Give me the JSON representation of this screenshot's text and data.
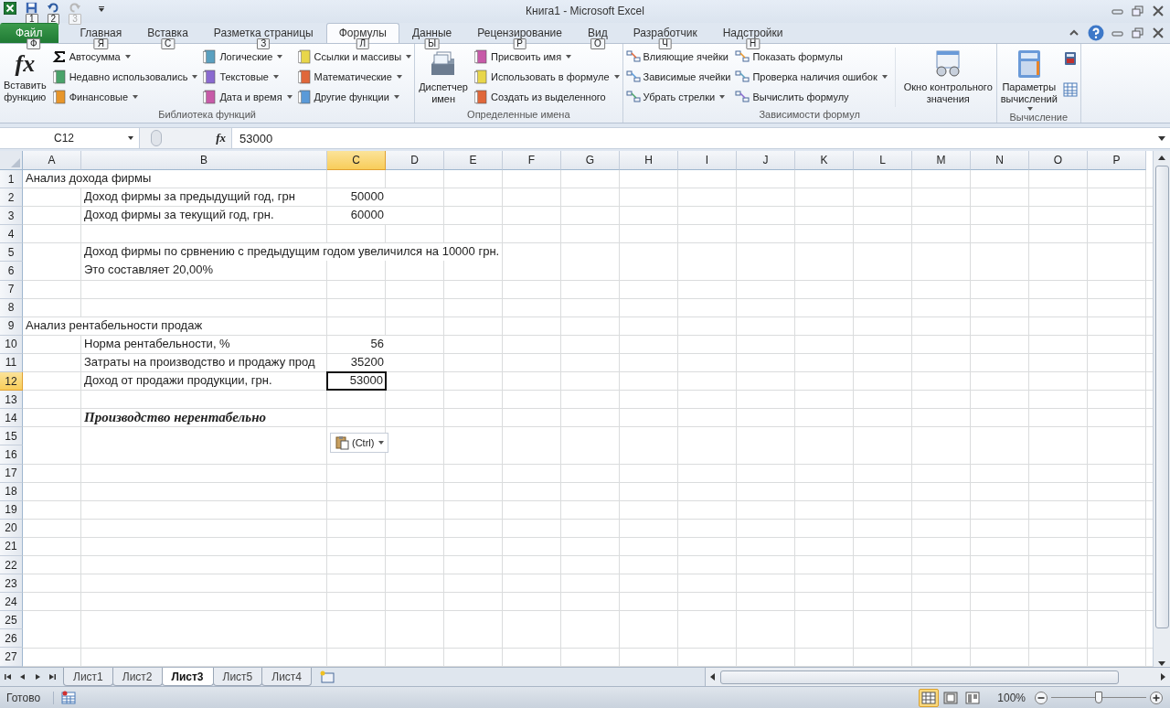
{
  "window": {
    "title": "Книга1  -  Microsoft Excel"
  },
  "quick_access": [
    {
      "keytip": "1",
      "disabled": false
    },
    {
      "keytip": "2",
      "disabled": false
    },
    {
      "keytip": "3",
      "disabled": true
    }
  ],
  "tabs": [
    {
      "label": "Файл",
      "keytip": "Ф",
      "kind": "file",
      "selected": false
    },
    {
      "label": "Главная",
      "keytip": "Я",
      "kind": "tab",
      "selected": false
    },
    {
      "label": "Вставка",
      "keytip": "С",
      "kind": "tab",
      "selected": false
    },
    {
      "label": "Разметка страницы",
      "keytip": "З",
      "kind": "tab",
      "selected": false
    },
    {
      "label": "Формулы",
      "keytip": "Л",
      "kind": "tab",
      "selected": true
    },
    {
      "label": "Данные",
      "keytip": "Ы",
      "kind": "tab",
      "selected": false
    },
    {
      "label": "Рецензирование",
      "keytip": "Р",
      "kind": "tab",
      "selected": false
    },
    {
      "label": "Вид",
      "keytip": "О",
      "kind": "tab",
      "selected": false
    },
    {
      "label": "Разработчик",
      "keytip": "Ч",
      "kind": "tab",
      "selected": false
    },
    {
      "label": "Надстройки",
      "keytip": "Н",
      "kind": "tab",
      "selected": false
    }
  ],
  "ribbon": [
    {
      "label": "Библиотека функций",
      "sections": [
        {
          "kind": "large",
          "icon_text": "fx",
          "lines": [
            "Вставить",
            "функцию"
          ],
          "dropdown": false
        },
        {
          "kind": "stack",
          "items": [
            {
              "label": "Автосумма",
              "dropdown": true
            },
            {
              "label": "Недавно использовались",
              "dropdown": true
            },
            {
              "label": "Финансовые",
              "dropdown": true
            }
          ]
        },
        {
          "kind": "stack",
          "items": [
            {
              "label": "Логические",
              "dropdown": true
            },
            {
              "label": "Текстовые",
              "dropdown": true
            },
            {
              "label": "Дата и время",
              "dropdown": true
            }
          ]
        },
        {
          "kind": "stack",
          "items": [
            {
              "label": "Ссылки и массивы",
              "dropdown": true
            },
            {
              "label": "Математические",
              "dropdown": true
            },
            {
              "label": "Другие функции",
              "dropdown": true
            }
          ]
        }
      ]
    },
    {
      "label": "Определенные имена",
      "sections": [
        {
          "kind": "large",
          "lines": [
            "Диспетчер",
            "имен"
          ],
          "dropdown": false
        },
        {
          "kind": "stack",
          "items": [
            {
              "label": "Присвоить имя",
              "dropdown": true
            },
            {
              "label": "Использовать в формуле",
              "dropdown": true
            },
            {
              "label": "Создать из выделенного",
              "dropdown": false
            }
          ]
        }
      ]
    },
    {
      "label": "Зависимости формул",
      "sections": [
        {
          "kind": "stack",
          "items": [
            {
              "label": "Влияющие ячейки",
              "dropdown": false
            },
            {
              "label": "Зависимые ячейки",
              "dropdown": false
            },
            {
              "label": "Убрать стрелки",
              "dropdown": true
            }
          ]
        },
        {
          "kind": "stack",
          "items": [
            {
              "label": "Показать формулы",
              "dropdown": false
            },
            {
              "label": "Проверка наличия ошибок",
              "dropdown": true
            },
            {
              "label": "Вычислить формулу",
              "dropdown": false
            }
          ]
        },
        {
          "kind": "large",
          "lines": [
            "Окно контрольного",
            "значения"
          ],
          "dropdown": false
        }
      ]
    },
    {
      "label": "Вычисление",
      "sections": [
        {
          "kind": "large",
          "lines": [
            "Параметры",
            "вычислений"
          ],
          "dropdown": true
        },
        {
          "kind": "icon_stack"
        }
      ]
    }
  ],
  "formula_bar": {
    "name_box": "C12",
    "fx": "fx",
    "value": "53000"
  },
  "columns": [
    {
      "label": "A",
      "selected": false
    },
    {
      "label": "B",
      "selected": false
    },
    {
      "label": "C",
      "selected": true
    },
    {
      "label": "D",
      "selected": false
    },
    {
      "label": "E",
      "selected": false
    },
    {
      "label": "F",
      "selected": false
    },
    {
      "label": "G",
      "selected": false
    },
    {
      "label": "H",
      "selected": false
    },
    {
      "label": "I",
      "selected": false
    },
    {
      "label": "J",
      "selected": false
    },
    {
      "label": "K",
      "selected": false
    },
    {
      "label": "L",
      "selected": false
    },
    {
      "label": "M",
      "selected": false
    },
    {
      "label": "N",
      "selected": false
    },
    {
      "label": "O",
      "selected": false
    },
    {
      "label": "P",
      "selected": false
    }
  ],
  "rows": [
    {
      "header": "1",
      "selected": false,
      "a": {
        "text": "Анализ дохода фирмы",
        "kind": "text"
      }
    },
    {
      "header": "2",
      "selected": false,
      "b": {
        "text": "Доход фирмы за предыдущий год, грн",
        "kind": "text"
      },
      "c": {
        "text": "50000",
        "kind": "number"
      }
    },
    {
      "header": "3",
      "selected": false,
      "b": {
        "text": "Доход фирмы за текущий год, грн.",
        "kind": "text"
      },
      "c": {
        "text": "60000",
        "kind": "number"
      }
    },
    {
      "header": "4",
      "selected": false
    },
    {
      "header": "5",
      "selected": false,
      "b": {
        "text": "Доход фирмы по срвнению с предыдущим годом увеличился на 10000 грн.",
        "kind": "text"
      }
    },
    {
      "header": "6",
      "selected": false,
      "b": {
        "text": "Это составляет 20,00%",
        "kind": "text"
      }
    },
    {
      "header": "7",
      "selected": false
    },
    {
      "header": "8",
      "selected": false
    },
    {
      "header": "9",
      "selected": false,
      "a": {
        "text": "Анализ рентабельности продаж",
        "kind": "text"
      }
    },
    {
      "header": "10",
      "selected": false,
      "b": {
        "text": "Норма рентабельности, %",
        "kind": "text"
      },
      "c": {
        "text": "56",
        "kind": "number"
      }
    },
    {
      "header": "11",
      "selected": false,
      "b": {
        "text": "Затраты на производство и продажу прод",
        "kind": "text"
      },
      "c": {
        "text": "35200",
        "kind": "number"
      }
    },
    {
      "header": "12",
      "selected": true,
      "b": {
        "text": "Доход от продажи продукции, грн.",
        "kind": "text"
      },
      "c": {
        "text": "53000",
        "kind": "number"
      }
    },
    {
      "header": "13",
      "selected": false
    },
    {
      "header": "14",
      "selected": false,
      "b": {
        "text": "Производство нерентабельно",
        "kind": "emphasis"
      }
    },
    {
      "header": "15",
      "selected": false
    },
    {
      "header": "16",
      "selected": false
    },
    {
      "header": "17",
      "selected": false
    },
    {
      "header": "18",
      "selected": false
    },
    {
      "header": "19",
      "selected": false
    },
    {
      "header": "20",
      "selected": false
    },
    {
      "header": "21",
      "selected": false
    },
    {
      "header": "22",
      "selected": false
    },
    {
      "header": "23",
      "selected": false
    },
    {
      "header": "24",
      "selected": false
    },
    {
      "header": "25",
      "selected": false
    },
    {
      "header": "26",
      "selected": false
    },
    {
      "header": "27",
      "selected": false
    }
  ],
  "paste_options": {
    "label": "(Ctrl)"
  },
  "sheet_tabs": [
    {
      "label": "Лист1",
      "selected": false
    },
    {
      "label": "Лист2",
      "selected": false
    },
    {
      "label": "Лист3",
      "selected": true
    },
    {
      "label": "Лист5",
      "selected": false
    },
    {
      "label": "Лист4",
      "selected": false
    }
  ],
  "status_bar": {
    "text": "Готово",
    "views": [
      {
        "kind": "normal",
        "selected": true
      },
      {
        "kind": "layout",
        "selected": false
      },
      {
        "kind": "pagebreak",
        "selected": false
      }
    ],
    "zoom": "100%",
    "zoom_slider": {
      "level": 0.5
    }
  }
}
